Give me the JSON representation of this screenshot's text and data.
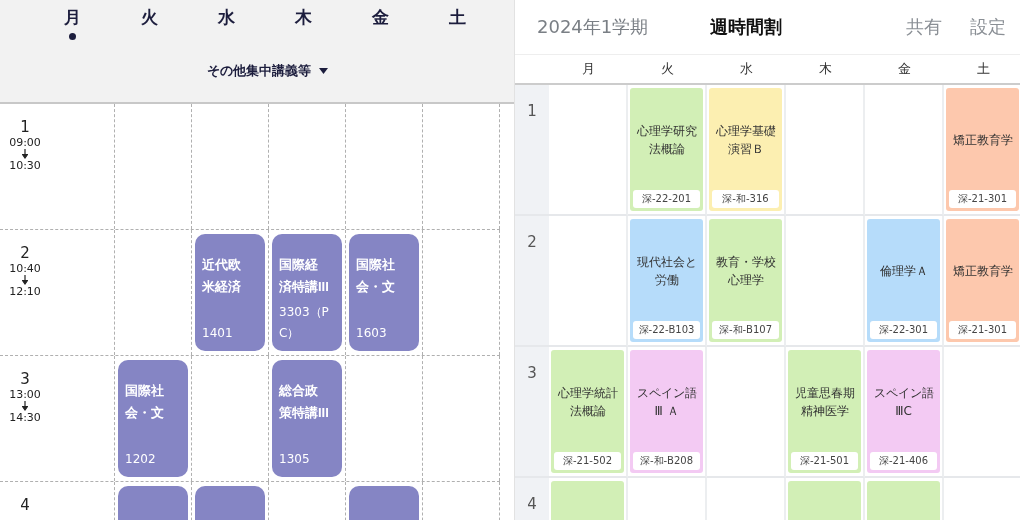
{
  "left_panel": {
    "days": [
      {
        "label": "月",
        "selected": true
      },
      {
        "label": "火",
        "selected": false
      },
      {
        "label": "水",
        "selected": false
      },
      {
        "label": "木",
        "selected": false
      },
      {
        "label": "金",
        "selected": false
      },
      {
        "label": "土",
        "selected": false
      }
    ],
    "filter_dropdown": {
      "label": "その他集中講義等"
    },
    "periods": [
      {
        "number": "1",
        "start": "09:00",
        "end": "10:30",
        "cells": [
          null,
          null,
          null,
          null,
          null
        ]
      },
      {
        "number": "2",
        "start": "10:40",
        "end": "12:10",
        "cells": [
          null,
          {
            "name": "近代欧米経済",
            "room": "1401"
          },
          {
            "name": "国際経済特講III",
            "room": "3303（PC）"
          },
          {
            "name": "国際社会・文",
            "room": "1603"
          },
          null
        ]
      },
      {
        "number": "3",
        "start": "13:00",
        "end": "14:30",
        "cells": [
          {
            "name": "国際社会・文",
            "room": "1202"
          },
          null,
          {
            "name": "総合政策特講III",
            "room": "1305"
          },
          null,
          null
        ]
      },
      {
        "number": "4",
        "cells": [
          {},
          {},
          null,
          {},
          null
        ]
      }
    ]
  },
  "right_panel": {
    "term": "2024年1学期",
    "title": "週時間割",
    "actions": [
      "共有",
      "設定"
    ],
    "days": [
      "月",
      "火",
      "水",
      "木",
      "金",
      "土"
    ],
    "periods": [
      {
        "number": "1",
        "cells": [
          null,
          {
            "name": "心理学研究法概論",
            "room": "深-22-201",
            "color": "#d2efb6"
          },
          {
            "name": "心理学基礎演習Ｂ",
            "room": "深-和-316",
            "color": "#fcefb1"
          },
          null,
          null,
          {
            "name": "矯正教育学",
            "room": "深-21-301",
            "color": "#fdc8ad"
          }
        ]
      },
      {
        "number": "2",
        "cells": [
          null,
          {
            "name": "現代社会と労働",
            "room": "深-22-B103",
            "color": "#b6dcfa"
          },
          {
            "name": "教育・学校心理学",
            "room": "深-和-B107",
            "color": "#d2efb6"
          },
          null,
          {
            "name": "倫理学Ａ",
            "room": "深-22-301",
            "color": "#b6dcfa"
          },
          {
            "name": "矯正教育学",
            "room": "深-21-301",
            "color": "#fdc8ad"
          }
        ]
      },
      {
        "number": "3",
        "cells": [
          {
            "name": "心理学統計法概論",
            "room": "深-21-502",
            "color": "#d2efb6"
          },
          {
            "name": "スペイン語Ⅲ Ａ",
            "room": "深-和-B208",
            "color": "#f3caf3"
          },
          null,
          {
            "name": "児童思春期精神医学",
            "room": "深-21-501",
            "color": "#d2efb6"
          },
          {
            "name": "スペイン語ⅢC",
            "room": "深-21-406",
            "color": "#f3caf3"
          },
          null
        ]
      },
      {
        "number": "4",
        "cells": [
          {
            "color": "#d2efb6"
          },
          null,
          null,
          {
            "color": "#d2efb6"
          },
          {
            "color": "#d2efb6"
          },
          null
        ]
      }
    ]
  }
}
